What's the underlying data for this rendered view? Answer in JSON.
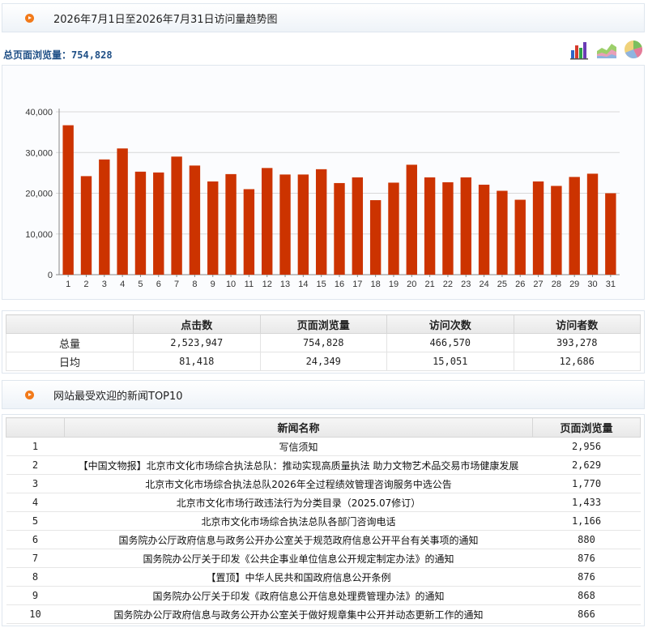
{
  "trend_section": {
    "title": "2026年7月1日至2026年7月31日访问量趋势图",
    "total_label": "总页面浏览量：",
    "total_value": "754,828",
    "icons": [
      "bar-chart-icon",
      "area-chart-icon",
      "pie-chart-icon"
    ]
  },
  "chart_data": {
    "type": "bar",
    "categories": [
      "1",
      "2",
      "3",
      "4",
      "5",
      "6",
      "7",
      "8",
      "9",
      "10",
      "11",
      "12",
      "13",
      "14",
      "15",
      "16",
      "17",
      "18",
      "19",
      "20",
      "21",
      "22",
      "23",
      "24",
      "25",
      "26",
      "27",
      "28",
      "29",
      "30",
      "31"
    ],
    "values": [
      36700,
      24200,
      28300,
      31000,
      25300,
      25100,
      29000,
      26800,
      22900,
      24700,
      21000,
      26200,
      24600,
      24600,
      25900,
      22500,
      23900,
      18300,
      22600,
      27000,
      23900,
      22700,
      23900,
      22100,
      20600,
      18400,
      22900,
      21800,
      24000,
      24800,
      20000
    ],
    "y_ticks": [
      "0",
      "10,000",
      "20,000",
      "30,000",
      "40,000"
    ],
    "ylim": [
      0,
      40000
    ],
    "bar_color": "#cc3300",
    "grid": true
  },
  "stats": {
    "headers": [
      "",
      "点击数",
      "页面浏览量",
      "访问次数",
      "访问者数"
    ],
    "rows": [
      {
        "label": "总量",
        "values": [
          "2,523,947",
          "754,828",
          "466,570",
          "393,278"
        ]
      },
      {
        "label": "日均",
        "values": [
          "81,418",
          "24,349",
          "15,051",
          "12,686"
        ]
      }
    ]
  },
  "news_section": {
    "title": "网站最受欢迎的新闻TOP10",
    "headers": [
      "",
      "新闻名称",
      "页面浏览量"
    ],
    "rows": [
      {
        "rank": "1",
        "title": "写信须知",
        "pv": "2,956"
      },
      {
        "rank": "2",
        "title": "【中国文物报】北京市文化市场综合执法总队：推动实现高质量执法 助力文物艺术品交易市场健康发展",
        "pv": "2,629"
      },
      {
        "rank": "3",
        "title": "北京市文化市场综合执法总队2026年全过程绩效管理咨询服务中选公告",
        "pv": "1,770"
      },
      {
        "rank": "4",
        "title": "北京市文化市场行政违法行为分类目录（2025.07修订）",
        "pv": "1,433"
      },
      {
        "rank": "5",
        "title": "北京市文化市场综合执法总队各部门咨询电话",
        "pv": "1,166"
      },
      {
        "rank": "6",
        "title": "国务院办公厅政府信息与政务公开办公室关于规范政府信息公开平台有关事项的通知",
        "pv": "880"
      },
      {
        "rank": "7",
        "title": "国务院办公厅关于印发《公共企事业单位信息公开规定制定办法》的通知",
        "pv": "876"
      },
      {
        "rank": "8",
        "title": "【置顶】中华人民共和国政府信息公开条例",
        "pv": "876"
      },
      {
        "rank": "9",
        "title": "国务院办公厅关于印发《政府信息公开信息处理费管理办法》的通知",
        "pv": "868"
      },
      {
        "rank": "10",
        "title": "国务院办公厅政府信息与政务公开办公室关于做好规章集中公开并动态更新工作的通知",
        "pv": "866"
      }
    ]
  }
}
